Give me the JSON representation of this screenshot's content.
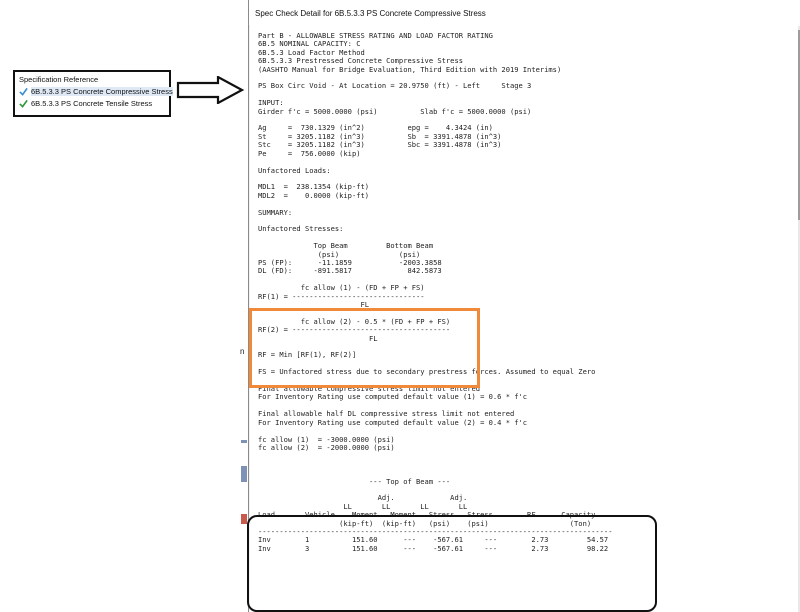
{
  "spec_panel": {
    "title": "Specification Reference",
    "items": [
      {
        "label": "6B.5.3.3 PS Concrete Compressive Stress",
        "check_color": "#3a8fd1",
        "selected": true
      },
      {
        "label": "6B.5.3.3 PS Concrete Tensile Stress",
        "check_color": "#2f9a3a",
        "selected": false
      }
    ]
  },
  "window": {
    "title": "Spec Check Detail for 6B.5.3.3 PS Concrete Compressive Stress"
  },
  "report": {
    "lines": [
      "Part B - ALLOWABLE STRESS RATING AND LOAD FACTOR RATING",
      "6B.5 NOMINAL CAPACITY: C",
      "6B.5.3 Load Factor Method",
      "6B.5.3.3 Prestressed Concrete Compressive Stress",
      "(AASHTO Manual for Bridge Evaluation, Third Edition with 2019 Interims)",
      "",
      "PS Box Circ Void - At Location = 20.9750 (ft) - Left     Stage 3",
      "",
      "INPUT:",
      "Girder f'c = 5000.0000 (psi)          Slab f'c = 5000.0000 (psi)",
      "",
      "Ag     =  730.1329 (in^2)          epg =    4.3424 (in)",
      "St     = 3205.1182 (in^3)          Sb  = 3391.4878 (in^3)",
      "Stc    = 3205.1182 (in^3)          Sbc = 3391.4878 (in^3)",
      "Pe     =  756.0000 (kip)",
      "",
      "Unfactored Loads:",
      "",
      "MDL1  =  238.1354 (kip-ft)",
      "MDL2  =    0.0000 (kip-ft)",
      "",
      "SUMMARY:",
      "",
      "Unfactored Stresses:",
      "",
      "             Top Beam         Bottom Beam",
      "              (psi)              (psi)",
      "PS (FP):      -11.1859           -2003.3858",
      "DL (FD):     -891.5817             842.5873",
      "",
      "          fc allow (1) - (FD + FP + FS)",
      "RF(1) = -------------------------------",
      "                        FL",
      "",
      "          fc allow (2) - 0.5 * (FD + FP + FS)",
      "RF(2) = -------------------------------------",
      "                          FL",
      "",
      "RF = Min [RF(1), RF(2)]",
      "",
      "FS = Unfactored stress due to secondary prestress forces. Assumed to equal Zero",
      "",
      "Final allowable compressive stress limit not entered",
      "For Inventory Rating use computed default value (1) = 0.6 * f'c",
      "",
      "Final allowable half DL compressive stress limit not entered",
      "For Inventory Rating use computed default value (2) = 0.4 * f'c",
      "",
      "fc allow (1)  = -3000.0000 (psi)",
      "fc allow (2)  = -2000.0000 (psi)",
      "",
      "",
      "",
      "                          --- Top of Beam ---",
      "",
      "                            Adj.             Adj.",
      "                    LL       LL       LL       LL",
      "Load       Vehicle    Moment   Moment   Stress   Stress        RF      Capacity",
      "                   (kip-ft)  (kip-ft)   (psi)    (psi)                   (Ton)",
      "-----------------------------------------------------------------------------------",
      "Inv        1          151.60      ---    -567.61     ---        2.73         54.57",
      "Inv        3          151.60      ---    -567.61     ---        2.73         98.22"
    ]
  }
}
